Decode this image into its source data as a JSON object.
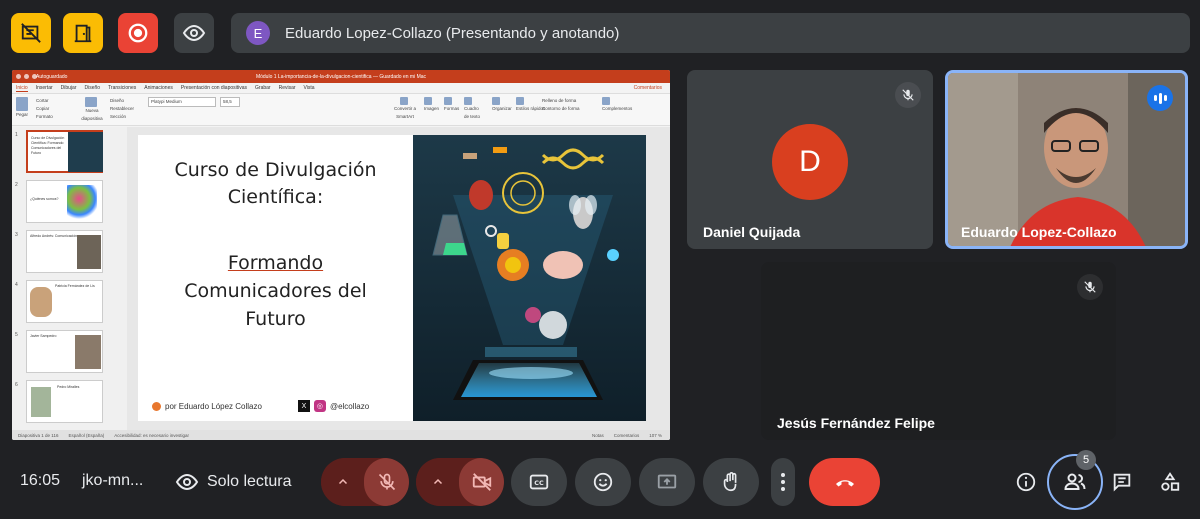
{
  "top": {
    "presenter_initial": "E",
    "presenter_text": "Eduardo Lopez-Collazo (Presentando y anotando)"
  },
  "ppt": {
    "autosave": "Autoguardado",
    "doc_title": "Módulo 1 La-importancia-de-la-divulgacion-cientifica — Guardado en mi Mac",
    "tabs": [
      "Inicio",
      "Insertar",
      "Dibujar",
      "Diseño",
      "Transiciones",
      "Animaciones",
      "Presentación con diapositivas",
      "Grabar",
      "Revisar",
      "Vista"
    ],
    "comments_btn": "Comentarios",
    "ribbon": {
      "pegar": "Pegar",
      "cortar": "Cortar",
      "copiar": "Copiar",
      "formato": "Formato",
      "nueva": "Nueva diapositiva",
      "diseno": "Diseño",
      "restablecer": "Restablecer",
      "seccion": "Sección",
      "font": "Platypi Medium",
      "size": "58,5",
      "imagen": "Imagen",
      "formas": "Formas",
      "cuadro": "Cuadro de texto",
      "organizar": "Organizar",
      "estilos": "Estilos rápidos",
      "relleno": "Relleno de forma",
      "contorno": "Contorno de forma",
      "convertir": "Convertir a SmartArt",
      "complementos": "Complementos"
    },
    "thumbs": [
      {
        "num": "1",
        "text": "Curso de Divulgación Científica: Formando Comunicadores del Futuro"
      },
      {
        "num": "2",
        "text": "¿Quiénes somos?"
      },
      {
        "num": "3",
        "text": "Alfredo Andrés: Comunicación"
      },
      {
        "num": "4",
        "text": "Patricia Fernández de Lis"
      },
      {
        "num": "5",
        "text": "Javier Sampedro"
      },
      {
        "num": "6",
        "text": "Pedro Miralles"
      }
    ],
    "status_left": "Diapositiva 1 de 116",
    "status_lang": "Español (España)",
    "status_access": "Accesibilidad: es necesario investigar",
    "status_notes": "Notas",
    "status_comments": "Comentarios",
    "zoom": "107 %"
  },
  "slide": {
    "title_line1": "Curso de Divulgación",
    "title_line2": "Científica:",
    "sub_line1": "Formando",
    "sub_line2": "Comunicadores del",
    "sub_line3": "Futuro",
    "author": "por Eduardo  López Collazo",
    "x_letter": "X",
    "handle": "@elcollazo"
  },
  "participants": [
    {
      "name": "Daniel Quijada",
      "initial": "D"
    },
    {
      "name": "Eduardo Lopez-Collazo"
    },
    {
      "name": "Jesús Fernández Felipe"
    }
  ],
  "bottom": {
    "time": "16:05",
    "meeting_code": "jko-mn...",
    "read_only": "Solo lectura",
    "people_count": "5"
  },
  "colors": {
    "accent_red": "#ea4335",
    "accent_yellow": "#fbbc04",
    "speaking_blue": "#1a73e8",
    "ppt_red": "#c43e1c"
  }
}
